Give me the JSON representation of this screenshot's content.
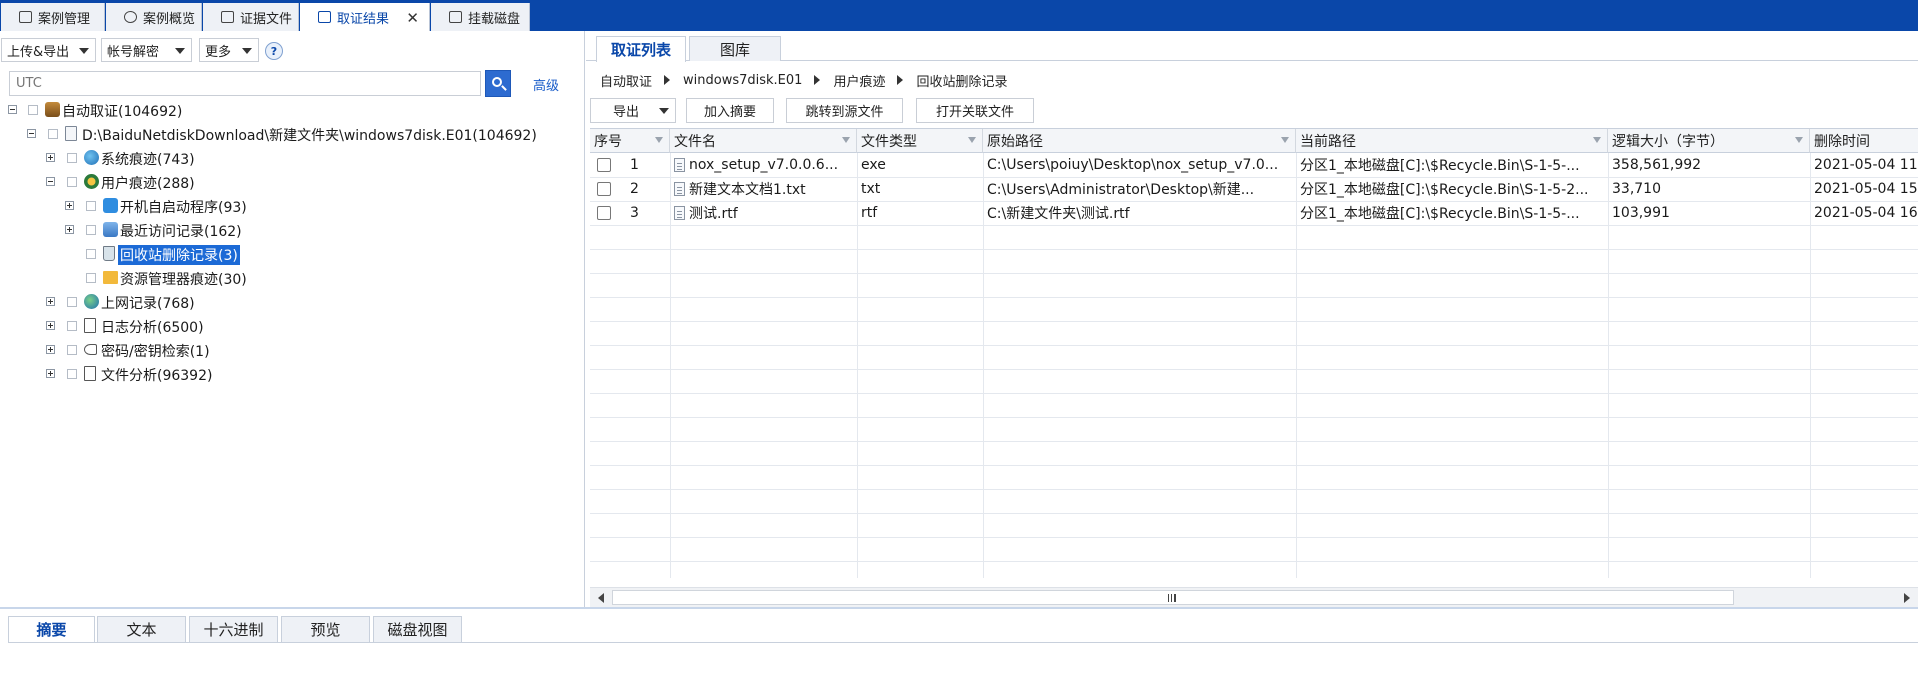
{
  "top_tabs": [
    {
      "label": "案例管理",
      "icon": "edit-icon"
    },
    {
      "label": "案例概览",
      "icon": "chart-icon"
    },
    {
      "label": "证据文件",
      "icon": "copy-icon"
    },
    {
      "label": "取证结果",
      "icon": "result-icon",
      "active": true,
      "close": "✕"
    },
    {
      "label": "挂载磁盘",
      "icon": "disk-icon"
    }
  ],
  "left": {
    "toolbar": {
      "upload_export": "上传&导出",
      "account_decrypt": "帐号解密",
      "more": "更多",
      "help": "?"
    },
    "search": {
      "placeholder": "UTC"
    },
    "advanced": "高级",
    "tree": [
      {
        "label": "自动取证(104692)",
        "icon": "auto-forensics-icon"
      },
      {
        "label": "D:\\BaiduNetdiskDownload\\新建文件夹\\windows7disk.E01(104692)",
        "icon": "disk-image-icon"
      },
      {
        "label": "系统痕迹(743)",
        "icon": "system-trace-icon"
      },
      {
        "label": "用户痕迹(288)",
        "icon": "user-trace-icon"
      },
      {
        "label": "开机自启动程序(93)",
        "icon": "startup-icon"
      },
      {
        "label": "最近访问记录(162)",
        "icon": "recent-icon"
      },
      {
        "label": "回收站删除记录(3)",
        "icon": "recycle-bin-icon",
        "selected": true
      },
      {
        "label": "资源管理器痕迹(30)",
        "icon": "folder-icon"
      },
      {
        "label": "上网记录(768)",
        "icon": "globe-icon"
      },
      {
        "label": "日志分析(6500)",
        "icon": "log-icon"
      },
      {
        "label": "密码/密钥检索(1)",
        "icon": "key-icon"
      },
      {
        "label": "文件分析(96392)",
        "icon": "file-analysis-icon"
      }
    ]
  },
  "right": {
    "tabs": [
      {
        "label": "取证列表",
        "active": true
      },
      {
        "label": "图库"
      }
    ],
    "breadcrumb": [
      "自动取证",
      "windows7disk.E01",
      "用户痕迹",
      "回收站删除记录"
    ],
    "buttons": {
      "export": "导出",
      "add_summary": "加入摘要",
      "jump_source": "跳转到源文件",
      "open_related": "打开关联文件"
    },
    "columns": [
      "序号",
      "文件名",
      "文件类型",
      "原始路径",
      "当前路径",
      "逻辑大小（字节）",
      "删除时间"
    ],
    "rows": [
      {
        "no": "1",
        "name": "nox_setup_v7.0.0.6...",
        "type": "exe",
        "orig": "C:\\Users\\poiuy\\Desktop\\nox_setup_v7.0...",
        "cur": "分区1_本地磁盘[C]:\\$Recycle.Bin\\S-1-5-...",
        "size": "358,561,992",
        "time": "2021-05-04 11:"
      },
      {
        "no": "2",
        "name": "新建文本文档1.txt",
        "type": "txt",
        "orig": "C:\\Users\\Administrator\\Desktop\\新建...",
        "cur": "分区1_本地磁盘[C]:\\$Recycle.Bin\\S-1-5-2...",
        "size": "33,710",
        "time": "2021-05-04 15:"
      },
      {
        "no": "3",
        "name": "测试.rtf",
        "type": "rtf",
        "orig": "C:\\新建文件夹\\测试.rtf",
        "cur": "分区1_本地磁盘[C]:\\$Recycle.Bin\\S-1-5-...",
        "size": "103,991",
        "time": "2021-05-04 16:"
      }
    ]
  },
  "bottom": {
    "tabs": [
      {
        "label": "摘要",
        "active": true
      },
      {
        "label": "文本"
      },
      {
        "label": "十六进制"
      },
      {
        "label": "预览"
      },
      {
        "label": "磁盘视图"
      }
    ]
  },
  "colors": {
    "brand": "#0a47a9",
    "selection": "#1c6ad6"
  }
}
